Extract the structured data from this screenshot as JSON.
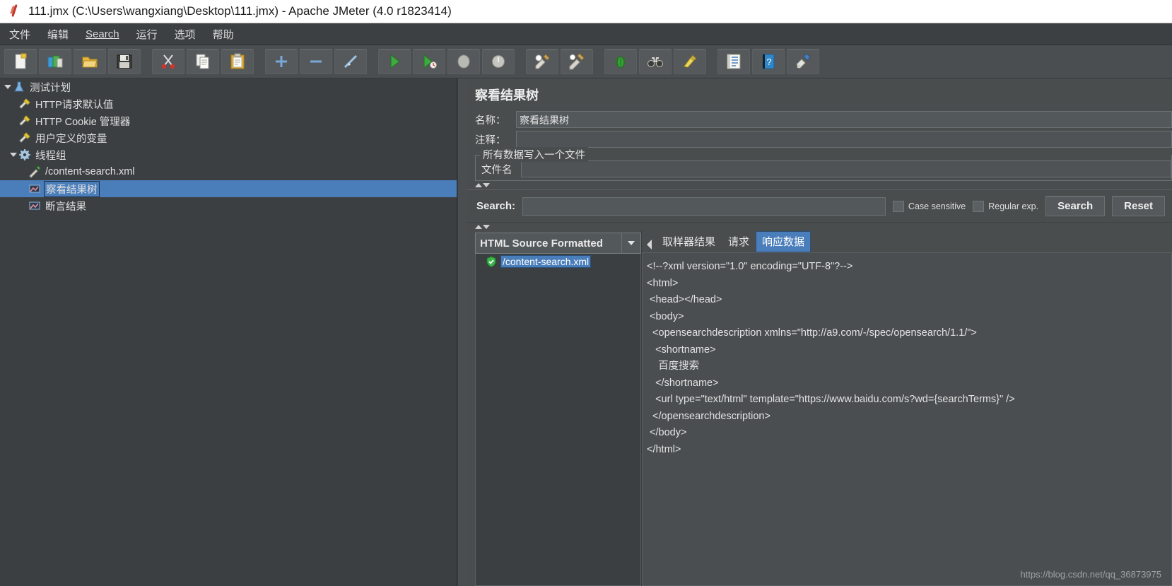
{
  "window": {
    "title": "111.jmx (C:\\Users\\wangxiang\\Desktop\\111.jmx) - Apache JMeter (4.0 r1823414)",
    "app_icon": "jmeter-feather-icon"
  },
  "menubar": {
    "items": [
      {
        "label": "文件",
        "name": "menu-file"
      },
      {
        "label": "编辑",
        "name": "menu-edit"
      },
      {
        "label": "Search",
        "name": "menu-search",
        "mnemonic": "S"
      },
      {
        "label": "运行",
        "name": "menu-run"
      },
      {
        "label": "选项",
        "name": "menu-options"
      },
      {
        "label": "帮助",
        "name": "menu-help"
      }
    ]
  },
  "toolbar": {
    "buttons": [
      {
        "name": "new-icon",
        "title": "新建"
      },
      {
        "name": "templates-icon",
        "title": "模板"
      },
      {
        "name": "open-icon",
        "title": "打开"
      },
      {
        "name": "save-icon",
        "title": "保存"
      },
      {
        "name": "cut-icon",
        "title": "剪切"
      },
      {
        "name": "copy-icon",
        "title": "复制"
      },
      {
        "name": "paste-icon",
        "title": "粘贴"
      },
      {
        "name": "expand-all-icon",
        "title": "展开"
      },
      {
        "name": "collapse-all-icon",
        "title": "收起"
      },
      {
        "name": "toggle-icon",
        "title": "切换"
      },
      {
        "name": "start-icon",
        "title": "启动"
      },
      {
        "name": "start-no-pauses-icon",
        "title": "无间隔启动"
      },
      {
        "name": "stop-icon",
        "title": "停止"
      },
      {
        "name": "shutdown-icon",
        "title": "关闭"
      },
      {
        "name": "clear-icon",
        "title": "清除"
      },
      {
        "name": "clear-all-icon",
        "title": "清除全部"
      },
      {
        "name": "search-bug-icon",
        "title": "查找"
      },
      {
        "name": "binoculars-icon",
        "title": "搜索"
      },
      {
        "name": "reset-search-icon",
        "title": "重置搜索"
      },
      {
        "name": "function-helper-icon",
        "title": "函数助手"
      },
      {
        "name": "help-icon",
        "title": "帮助"
      },
      {
        "name": "templates2-icon",
        "title": "模板"
      }
    ]
  },
  "tree": {
    "items": [
      {
        "label": "测试计划",
        "icon": "test-plan-icon",
        "depth": 0,
        "expanded": true,
        "selected": false
      },
      {
        "label": "HTTP请求默认值",
        "icon": "config-element-icon",
        "depth": 1,
        "expanded": null,
        "selected": false
      },
      {
        "label": "HTTP Cookie 管理器",
        "icon": "config-element-icon",
        "depth": 1,
        "expanded": null,
        "selected": false
      },
      {
        "label": "用户定义的变量",
        "icon": "config-element-icon",
        "depth": 1,
        "expanded": null,
        "selected": false
      },
      {
        "label": "线程组",
        "icon": "thread-group-icon",
        "depth": 1,
        "expanded": true,
        "selected": false
      },
      {
        "label": "/content-search.xml",
        "icon": "http-sampler-icon",
        "depth": 2,
        "expanded": null,
        "selected": false
      },
      {
        "label": "察看结果树",
        "icon": "view-results-tree-icon",
        "depth": 2,
        "expanded": null,
        "selected": true
      },
      {
        "label": "断言结果",
        "icon": "assertion-results-icon",
        "depth": 2,
        "expanded": null,
        "selected": false
      }
    ]
  },
  "panel": {
    "title": "察看结果树",
    "name_label": "名称：",
    "name_value": "察看结果树",
    "comment_label": "注释：",
    "comment_value": "",
    "group_legend": "所有数据写入一个文件",
    "filename_label": "文件名",
    "filename_value": ""
  },
  "search": {
    "label": "Search:",
    "value": "",
    "case_sensitive_label": "Case sensitive",
    "case_sensitive_checked": false,
    "regular_exp_label": "Regular exp.",
    "regular_exp_checked": false,
    "search_button": "Search",
    "reset_button": "Reset"
  },
  "results": {
    "renderer_selected": "HTML Source Formatted",
    "nodes": [
      {
        "label": "/content-search.xml",
        "icon": "success-shield-icon",
        "selected": true
      }
    ],
    "tabs": [
      {
        "label": "取样器结果",
        "active": false
      },
      {
        "label": "请求",
        "active": false
      },
      {
        "label": "响应数据",
        "active": true
      }
    ],
    "response_lines": [
      "<!--?xml version=\"1.0\" encoding=\"UTF-8\"?-->",
      "<html>",
      " <head></head>",
      " <body>",
      "  <opensearchdescription xmlns=\"http://a9.com/-/spec/opensearch/1.1/\">",
      "   <shortname>",
      "    百度搜索",
      "   </shortname>",
      "   <url type=\"text/html\" template=\"https://www.baidu.com/s?wd={searchTerms}\" />",
      "  </opensearchdescription>",
      " </body>",
      "</html>"
    ]
  },
  "watermark": "https://blog.csdn.net/qq_36873975",
  "colors": {
    "selection_blue": "#4a7ebb",
    "panel_bg": "#494d4e",
    "tree_bg": "#3b3f41",
    "title_bg": "#ffffff"
  }
}
